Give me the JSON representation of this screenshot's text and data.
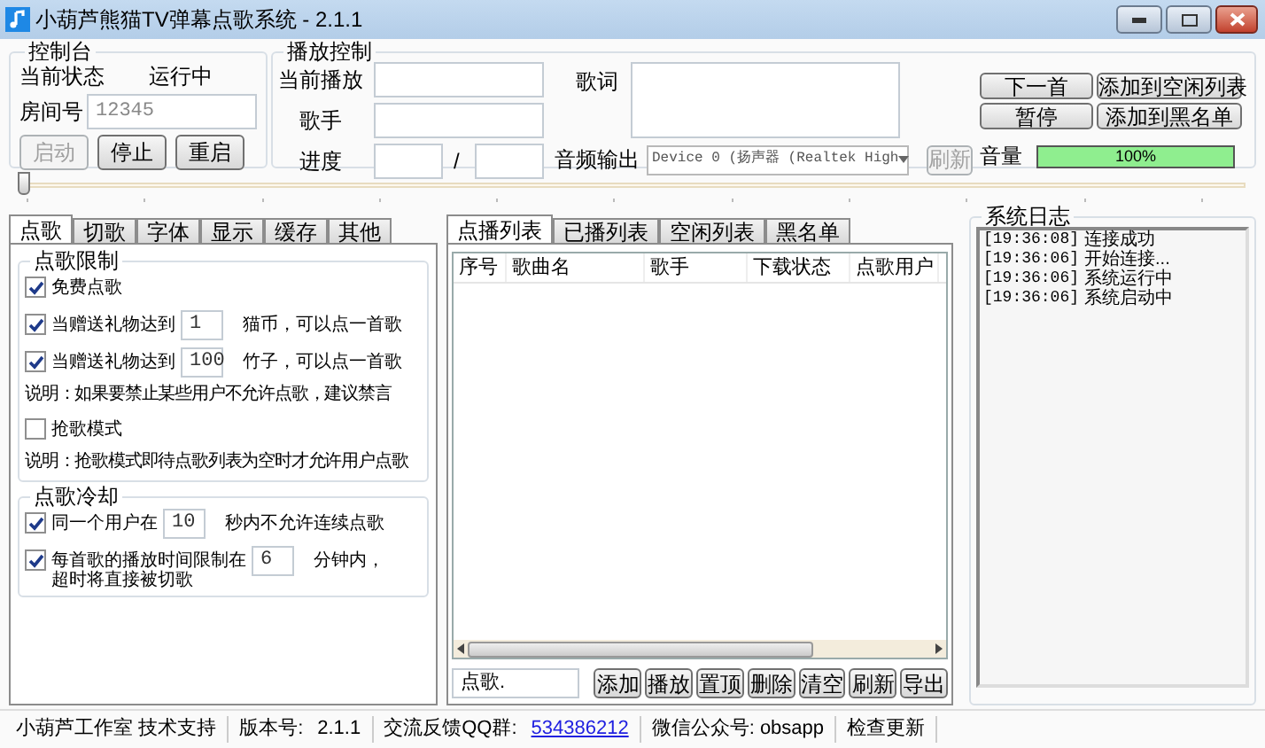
{
  "window": {
    "title": "小葫芦熊猫TV弹幕点歌系统 - 2.1.1"
  },
  "control_panel": {
    "title": "控制台",
    "status_label": "当前状态",
    "status_value": "运行中",
    "room_label": "房间号",
    "room_value": "12345",
    "buttons": [
      {
        "label": "启动",
        "disabled": true
      },
      {
        "label": "停止",
        "disabled": false
      },
      {
        "label": "重启",
        "disabled": false
      }
    ]
  },
  "playback": {
    "title": "播放控制",
    "now_playing_label": "当前播放",
    "singer_label": "歌手",
    "progress_label": "进度",
    "progress_separator": "/",
    "lyrics_label": "歌词",
    "audio_output_label": "音频输出",
    "audio_device": "Device 0 (扬声器 (Realtek High",
    "refresh": {
      "label": "刷新",
      "disabled": true
    },
    "buttons": [
      {
        "label": "下一首"
      },
      {
        "label": "添加到空闲列表"
      },
      {
        "label": "暂停"
      },
      {
        "label": "添加到黑名单"
      }
    ],
    "volume_label": "音量",
    "volume": {
      "level": 1.0,
      "reading": "100%"
    }
  },
  "seek_slider": {
    "level": 0
  },
  "settings_tabs": [
    {
      "label": "点歌",
      "selected": true
    },
    {
      "label": "切歌",
      "selected": false
    },
    {
      "label": "字体",
      "selected": false
    },
    {
      "label": "显示",
      "selected": false
    },
    {
      "label": "缓存",
      "selected": false
    },
    {
      "label": "其他",
      "selected": false
    }
  ],
  "settings_sections": [
    {
      "title": "点歌限制",
      "rows": [
        {
          "kind": "checkbox",
          "label": "免费点歌",
          "checked": true
        },
        {
          "kind": "checkbox",
          "label": "当赠送礼物达到",
          "checked": true,
          "value": "1",
          "suffix": "猫币，可以点一首歌"
        },
        {
          "kind": "checkbox",
          "label": "当赠送礼物达到",
          "checked": true,
          "value": "100",
          "suffix": "竹子，可以点一首歌"
        },
        {
          "kind": "note",
          "text": "说明：如果要禁止某些用户不允许点歌，建议禁言"
        },
        {
          "kind": "checkbox",
          "label": "抢歌模式",
          "checked": false
        },
        {
          "kind": "note",
          "text": "说明：抢歌模式即待点歌列表为空时才允许用户点歌"
        }
      ]
    },
    {
      "title": "点歌冷却",
      "rows": [
        {
          "kind": "checkbox",
          "label": "同一个用户在",
          "checked": true,
          "value": "10",
          "suffix": "秒内不允许连续点歌"
        },
        {
          "kind": "checkbox",
          "label": "每首歌的播放时间限制在",
          "checked": true,
          "value": "6",
          "suffix": "分钟内，",
          "second_line": "超时将直接被切歌"
        }
      ]
    }
  ],
  "list_tabs": [
    {
      "label": "点播列表",
      "selected": true
    },
    {
      "label": "已播列表",
      "selected": false
    },
    {
      "label": "空闲列表",
      "selected": false
    },
    {
      "label": "黑名单",
      "selected": false
    }
  ],
  "table": {
    "columns": [
      "序号",
      "歌曲名",
      "歌手",
      "下载状态",
      "点歌用户"
    ]
  },
  "request_field": {
    "value": "点歌."
  },
  "list_buttons": [
    "添加",
    "播放",
    "置顶",
    "删除",
    "清空",
    "刷新",
    "导出"
  ],
  "log": {
    "title": "系统日志",
    "entries": [
      {
        "time": "[19:36:08]",
        "message": "连接成功"
      },
      {
        "time": "[19:36:06]",
        "message": "开始连接..."
      },
      {
        "time": "[19:36:06]",
        "message": "系统运行中"
      },
      {
        "time": "[19:36:06]",
        "message": "系统启动中"
      }
    ]
  },
  "status_bar": [
    {
      "kind": "text",
      "text": "小葫芦工作室 技术支持"
    },
    {
      "kind": "text",
      "text": "版本号:",
      "value": "2.1.1"
    },
    {
      "kind": "text",
      "text": "交流反馈QQ群:",
      "link": "534386212"
    },
    {
      "kind": "text",
      "text": "微信公众号: obsapp"
    },
    {
      "kind": "text",
      "text": "检查更新"
    }
  ]
}
